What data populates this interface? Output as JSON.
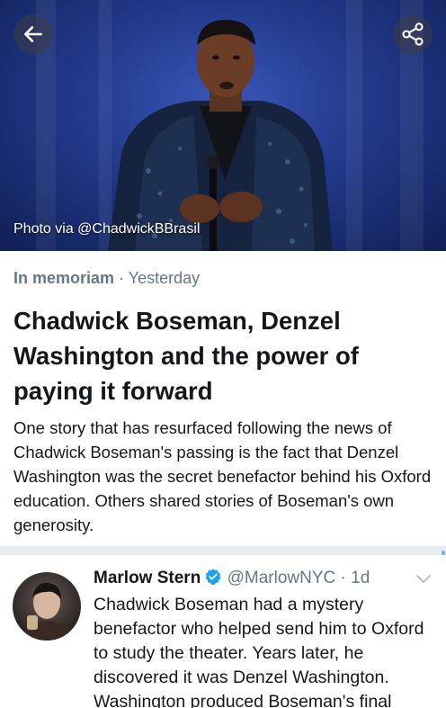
{
  "hero": {
    "photo_credit": "Photo via @ChadwickBBrasil",
    "back_icon": "arrow-left-icon",
    "share_icon": "share-icon"
  },
  "article": {
    "category": "In memoriam",
    "separator": " · ",
    "time": "Yesterday",
    "headline": "Chadwick Boseman, Denzel Washington and the power of paying it forward",
    "summary": "One story that has resurfaced following the news of Chadwick Boseman's passing is the fact that Denzel Washington was the secret benefactor behind his Oxford education. Others shared stories of Boseman's own generosity."
  },
  "tweet": {
    "author": "Marlow Stern",
    "handle": "@MarlowNYC",
    "separator": " · ",
    "time": "1d",
    "text": "Chadwick Boseman had a mystery benefactor who helped send him to Oxford to study the theater. Years later, he discovered it was Denzel Washington. Washington produced Boseman's final",
    "verified_color": "#1da1f2"
  },
  "colors": {
    "text": "#14171a",
    "secondary": "#657786",
    "divider": "#e6ecf0"
  }
}
